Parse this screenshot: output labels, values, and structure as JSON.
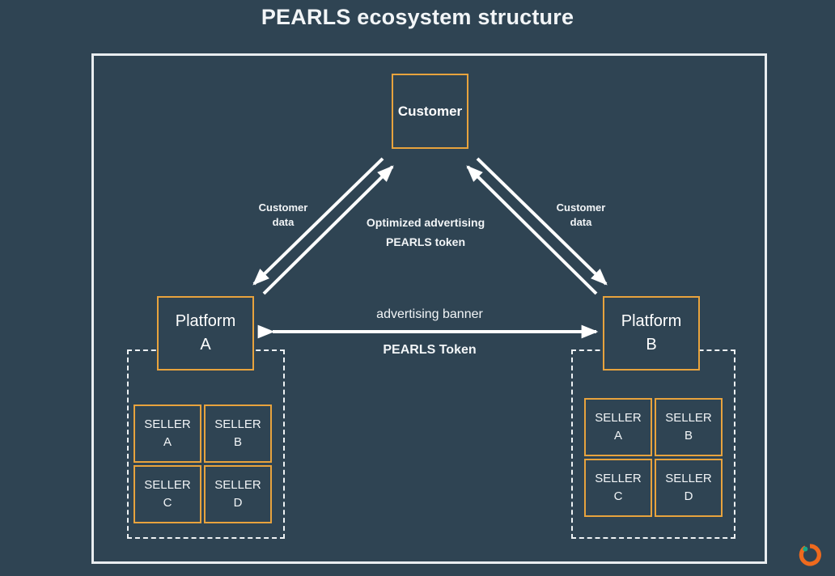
{
  "title": "PEARLS ecosystem structure",
  "theme": {
    "background": "#2f4453",
    "frame_border": "#e9edf0",
    "node_border": "#e8a33d",
    "text": "#f2f5f7",
    "dashed_border": "#eef2f4",
    "logo_ring": "#ee6a1e",
    "logo_dot": "#17a887"
  },
  "nodes": {
    "customer": {
      "label": "Customer"
    },
    "platform_a": {
      "line1": "Platform",
      "line2": "A"
    },
    "platform_b": {
      "line1": "Platform",
      "line2": "B"
    }
  },
  "sellers_a": [
    {
      "line1": "SELLER",
      "line2": "A"
    },
    {
      "line1": "SELLER",
      "line2": "B"
    },
    {
      "line1": "SELLER",
      "line2": "C"
    },
    {
      "line1": "SELLER",
      "line2": "D"
    }
  ],
  "sellers_b": [
    {
      "line1": "SELLER",
      "line2": "A"
    },
    {
      "line1": "SELLER",
      "line2": "B"
    },
    {
      "line1": "SELLER",
      "line2": "C"
    },
    {
      "line1": "SELLER",
      "line2": "D"
    }
  ],
  "flows": {
    "customer_data_left": {
      "line1": "Customer",
      "line2": "data"
    },
    "customer_data_right": {
      "line1": "Customer",
      "line2": "data"
    },
    "optimized_advertising": "Optimized advertising",
    "pearls_token_center": "PEARLS token",
    "advertising_banner": "advertising banner",
    "pearls_token_bottom": "PEARLS Token"
  }
}
